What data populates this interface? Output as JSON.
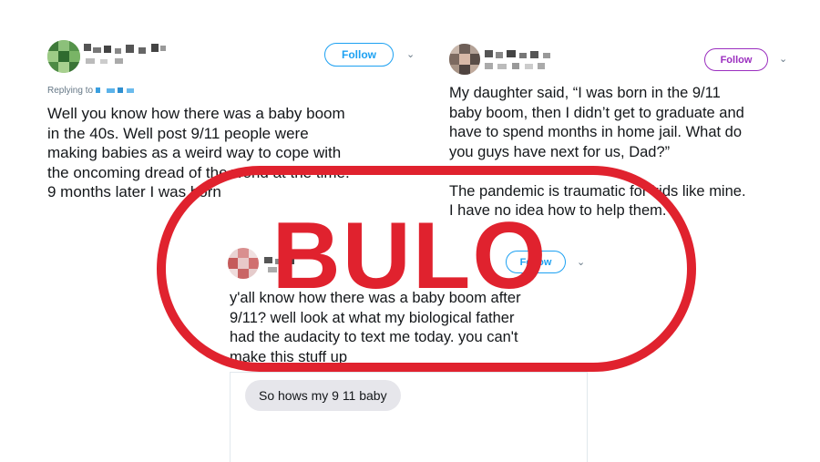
{
  "tweets": [
    {
      "follow_label": "Follow",
      "replying_to": "Replying to",
      "text": "Well you know how there was a baby boom\nin the 40s. Well post 9/11 people were\nmaking babies as a weird way to cope with\nthe oncoming dread of the world at the time.\n9 months later I was born"
    },
    {
      "follow_label": "Follow",
      "text": "My daughter said, “I was born in the 9/11\nbaby boom, then I didn’t get to graduate and\nhave to spend months in home jail. What do\nyou guys have next for us, Dad?”\n\nThe pandemic is traumatic for kids like mine.\nI have no idea how to help them."
    },
    {
      "follow_label": "Follow",
      "text": "y'all know how there was a baby boom after\n9/11? well look at what my biological father\nhad the audacity to text me today. you can't\nmake this stuff up",
      "dm_message": "So hows my 9 11 baby"
    }
  ],
  "stamp": {
    "label": "BULO",
    "color": "#e0222e"
  },
  "colors": {
    "follow_blue": "#1da1f2",
    "follow_purple": "#9b2fbf",
    "text": "#14171a",
    "muted": "#657786",
    "bubble": "#e6e6eb"
  },
  "icons": [
    "blurred-avatar",
    "blurred-name",
    "chevron-down-icon"
  ]
}
